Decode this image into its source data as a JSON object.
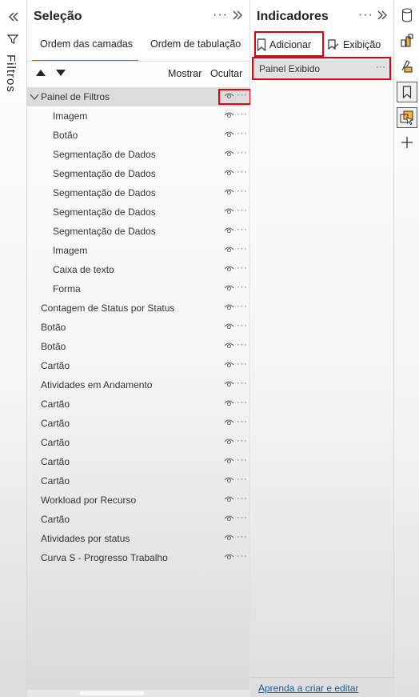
{
  "filters": {
    "label": "Filtros"
  },
  "selection": {
    "title": "Seleção",
    "more": "···",
    "tabs": [
      {
        "label": "Ordem das camadas",
        "active": true
      },
      {
        "label": "Ordem de tabulação",
        "active": false
      }
    ],
    "show_label": "Mostrar",
    "hide_label": "Ocultar",
    "rows": [
      {
        "label": "Painel de Filtros",
        "indent": 1,
        "group": true,
        "selected": true
      },
      {
        "label": "Imagem",
        "indent": 2
      },
      {
        "label": "Botão",
        "indent": 2
      },
      {
        "label": "Segmentação de Dados",
        "indent": 2
      },
      {
        "label": "Segmentação de Dados",
        "indent": 2
      },
      {
        "label": "Segmentação de Dados",
        "indent": 2
      },
      {
        "label": "Segmentação de Dados",
        "indent": 2
      },
      {
        "label": "Segmentação de Dados",
        "indent": 2
      },
      {
        "label": "Imagem",
        "indent": 2
      },
      {
        "label": "Caixa de texto",
        "indent": 2
      },
      {
        "label": "Forma",
        "indent": 2
      },
      {
        "label": "Contagem de Status por Status",
        "indent": 1
      },
      {
        "label": "Botão",
        "indent": 1
      },
      {
        "label": "Botão",
        "indent": 1
      },
      {
        "label": "Cartão",
        "indent": 1
      },
      {
        "label": "Atividades em Andamento",
        "indent": 1
      },
      {
        "label": "Cartão",
        "indent": 1
      },
      {
        "label": "Cartão",
        "indent": 1
      },
      {
        "label": "Cartão",
        "indent": 1
      },
      {
        "label": "Cartão",
        "indent": 1
      },
      {
        "label": "Cartão",
        "indent": 1
      },
      {
        "label": "Workload por Recurso",
        "indent": 1
      },
      {
        "label": "Cartão",
        "indent": 1
      },
      {
        "label": "Atividades por status",
        "indent": 1
      },
      {
        "label": "Curva S - Progresso Trabalho",
        "indent": 1
      }
    ],
    "row_more": "···"
  },
  "bookmarks": {
    "title": "Indicadores",
    "more": "···",
    "add_label": "Adicionar",
    "view_label": "Exibição",
    "items": [
      {
        "label": "Painel Exibido",
        "more": "···"
      }
    ],
    "learn_link": "Aprenda a criar e editar"
  },
  "rail": {
    "icons": [
      "data-icon",
      "build-visual-icon",
      "format-paintbrush-icon",
      "bookmark-icon",
      "selection-icon",
      "add-icon"
    ]
  },
  "colors": {
    "highlight": "#e3000f",
    "accent": "#118dff",
    "selected_row": "#dcdcdc"
  }
}
